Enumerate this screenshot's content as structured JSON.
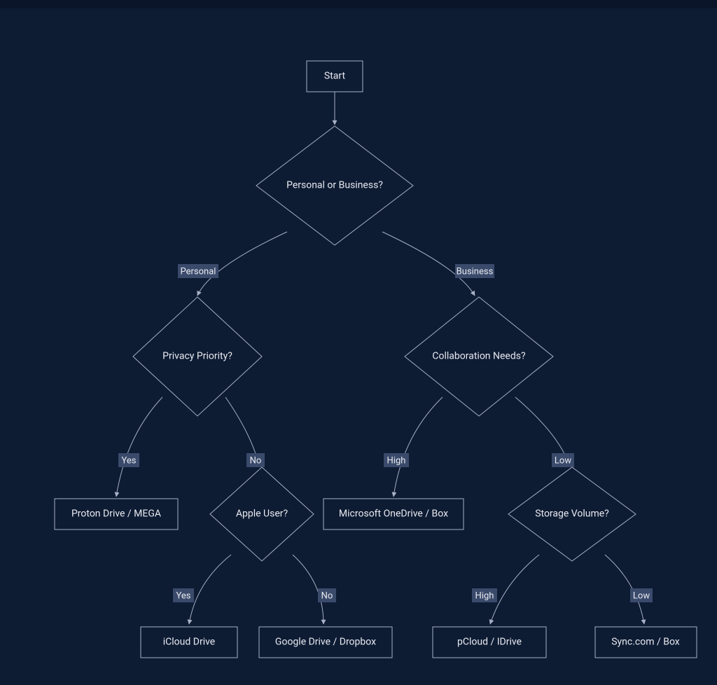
{
  "chart_data": {
    "type": "flowchart",
    "title": "",
    "nodes": [
      {
        "id": "start",
        "shape": "rect",
        "label": "Start"
      },
      {
        "id": "pob",
        "shape": "diamond",
        "label": "Personal or Business?"
      },
      {
        "id": "privacy",
        "shape": "diamond",
        "label": "Privacy Priority?"
      },
      {
        "id": "collab",
        "shape": "diamond",
        "label": "Collaboration Needs?"
      },
      {
        "id": "proton",
        "shape": "rect",
        "label": "Proton Drive / MEGA"
      },
      {
        "id": "apple",
        "shape": "diamond",
        "label": "Apple User?"
      },
      {
        "id": "msod",
        "shape": "rect",
        "label": "Microsoft OneDrive / Box"
      },
      {
        "id": "storage",
        "shape": "diamond",
        "label": "Storage Volume?"
      },
      {
        "id": "icloud",
        "shape": "rect",
        "label": "iCloud Drive"
      },
      {
        "id": "gdrive",
        "shape": "rect",
        "label": "Google Drive / Dropbox"
      },
      {
        "id": "pcloud",
        "shape": "rect",
        "label": "pCloud / IDrive"
      },
      {
        "id": "sync",
        "shape": "rect",
        "label": "Sync.com / Box"
      }
    ],
    "edges": [
      {
        "from": "start",
        "to": "pob",
        "label": ""
      },
      {
        "from": "pob",
        "to": "privacy",
        "label": "Personal"
      },
      {
        "from": "pob",
        "to": "collab",
        "label": "Business"
      },
      {
        "from": "privacy",
        "to": "proton",
        "label": "Yes"
      },
      {
        "from": "privacy",
        "to": "apple",
        "label": "No"
      },
      {
        "from": "collab",
        "to": "msod",
        "label": "High"
      },
      {
        "from": "collab",
        "to": "storage",
        "label": "Low"
      },
      {
        "from": "apple",
        "to": "icloud",
        "label": "Yes"
      },
      {
        "from": "apple",
        "to": "gdrive",
        "label": "No"
      },
      {
        "from": "storage",
        "to": "pcloud",
        "label": "High"
      },
      {
        "from": "storage",
        "to": "sync",
        "label": "Low"
      }
    ]
  },
  "labels": {
    "start": "Start",
    "pob": "Personal or Business?",
    "privacy": "Privacy Priority?",
    "collab": "Collaboration Needs?",
    "proton": "Proton Drive / MEGA",
    "apple": "Apple User?",
    "msod": "Microsoft OneDrive / Box",
    "storage": "Storage Volume?",
    "icloud": "iCloud Drive",
    "gdrive": "Google Drive / Dropbox",
    "pcloud": "pCloud / IDrive",
    "sync": "Sync.com / Box",
    "edge_personal": "Personal",
    "edge_business": "Business",
    "edge_yes1": "Yes",
    "edge_no1": "No",
    "edge_high1": "High",
    "edge_low1": "Low",
    "edge_yes2": "Yes",
    "edge_no2": "No",
    "edge_high2": "High",
    "edge_low2": "Low"
  }
}
